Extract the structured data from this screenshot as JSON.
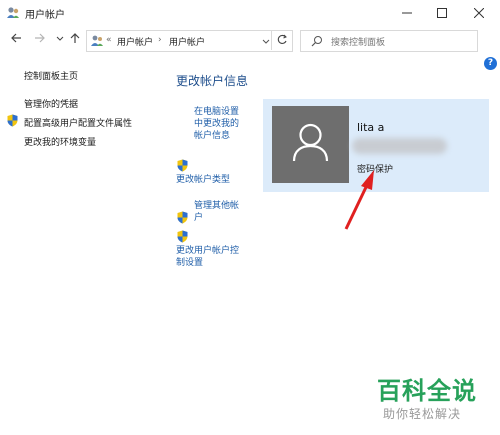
{
  "window": {
    "title": "用户帐户",
    "controls": [
      "minimize",
      "maximize",
      "close"
    ]
  },
  "address_bar": {
    "prefix": "«",
    "crumbs": [
      "用户帐户",
      "用户帐户"
    ],
    "search_placeholder": "搜索控制面板"
  },
  "left_nav": {
    "home": "控制面板主页",
    "items": [
      "管理你的凭据",
      "配置高级用户配置文件属性",
      "更改我的环境变量"
    ]
  },
  "main": {
    "heading": "更改帐户信息",
    "links": [
      "在电脑设置中更改我的帐户信息",
      "更改帐户类型",
      "管理其他帐户",
      "更改用户帐户控制设置"
    ],
    "link_lines": [
      [
        "在电脑设置",
        "中更改我的",
        "帐户信息"
      ],
      [
        "更改帐户类型"
      ],
      [
        "管理其他帐",
        "户"
      ],
      [
        "更改用户帐户控",
        "制设置"
      ]
    ]
  },
  "account": {
    "name": "lita a",
    "status": "密码保护"
  },
  "watermark": {
    "title": "百科全说",
    "subtitle": "助你轻松解决"
  },
  "colors": {
    "panel": "#dcebfa",
    "heading": "#1e4e8c",
    "link": "#1f5ea8",
    "annotation_arrow": "#e02020",
    "watermark": "#27a15a"
  }
}
